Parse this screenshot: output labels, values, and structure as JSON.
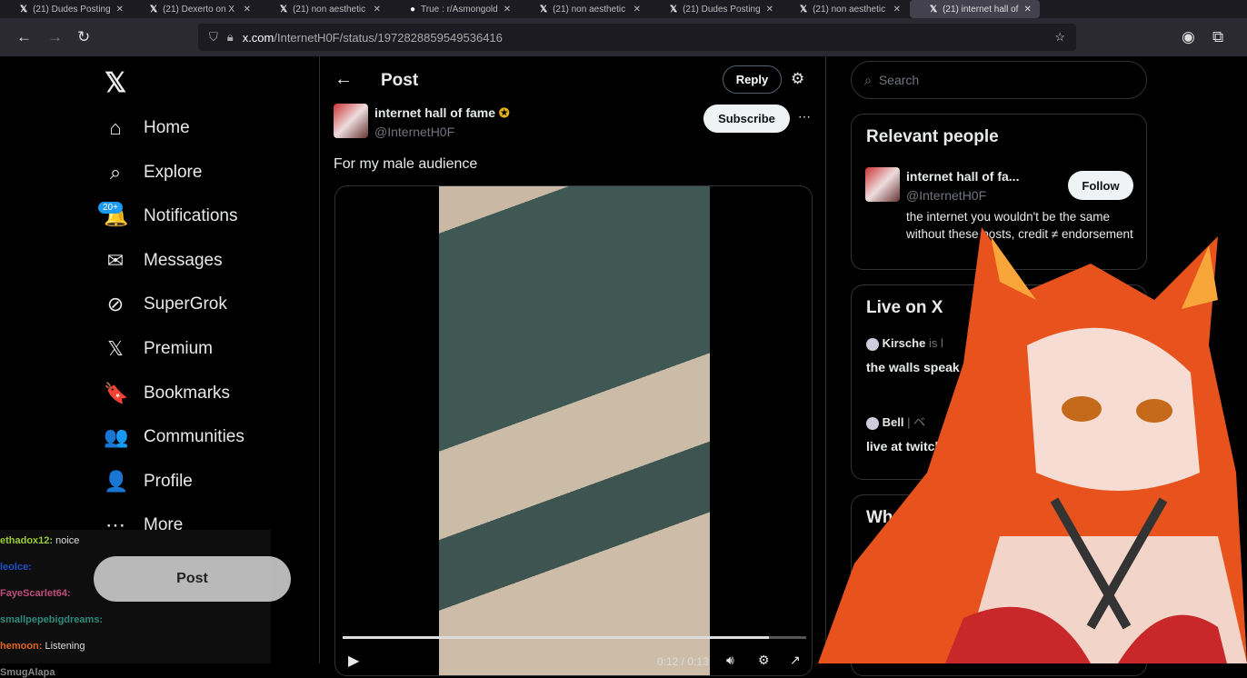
{
  "browser": {
    "tabs": [
      "(21) Dudes Posting",
      "(21) Dexerto on X",
      "(21) non aesthetic",
      "True : r/Asmongold",
      "(21) non aesthetic",
      "(21) Dudes Posting",
      "(21) non aesthetic",
      "(21) internet hall of"
    ],
    "url_host": "x.com",
    "url_path": "/InternetH0F/status/1972828859549536416"
  },
  "sidebar": {
    "items": [
      {
        "label": "Home",
        "icon": "⌂"
      },
      {
        "label": "Explore",
        "icon": "⌕"
      },
      {
        "label": "Notifications",
        "icon": "🔔"
      },
      {
        "label": "Messages",
        "icon": "✉"
      },
      {
        "label": "SuperGrok",
        "icon": "⊘"
      },
      {
        "label": "Premium",
        "icon": "𝕏"
      },
      {
        "label": "Bookmarks",
        "icon": "🔖"
      },
      {
        "label": "Communities",
        "icon": "👥"
      },
      {
        "label": "Profile",
        "icon": "👤"
      },
      {
        "label": "More",
        "icon": "⋯"
      }
    ],
    "notif_badge": "20+",
    "post_label": "Post"
  },
  "chat": [
    {
      "user": "ethadox12:",
      "msg": "noice",
      "color": "#9acd32"
    },
    {
      "user": "leolce:",
      "msg": "",
      "color": "#1e50c8"
    },
    {
      "user": "FayeScarlet64:",
      "msg": "",
      "color": "#c04a7a"
    },
    {
      "user": "smallpepebigdreams:",
      "msg": "",
      "color": "#2e8b7a"
    },
    {
      "user": "hemoon:",
      "msg": "Listening",
      "color": "#e0641e"
    },
    {
      "user": "SmugAlapa",
      "msg": "",
      "color": "#888"
    }
  ],
  "post": {
    "header": "Post",
    "reply": "Reply",
    "author": "internet hall of fame",
    "handle": "@InternetH0F",
    "subscribe": "Subscribe",
    "text": "For my male audience",
    "video": {
      "progress": 0.92,
      "time": "0:12 / 0:13"
    }
  },
  "right": {
    "search_placeholder": "Search",
    "relevant_title": "Relevant people",
    "person_name": "internet hall of fa...",
    "person_handle": "@InternetH0F",
    "follow": "Follow",
    "bio": "the internet you wouldn't be the same without these posts, credit ≠ endorsement",
    "live_title": "Live on X",
    "live": [
      {
        "name": "Kirsche",
        "suffix": "is l",
        "text": "the walls speak in s"
      },
      {
        "name": "Bell",
        "suffix": "| ベ",
        "text": "live at twitch.t cutting a cu"
      }
    ],
    "whats_title": "Wha"
  }
}
